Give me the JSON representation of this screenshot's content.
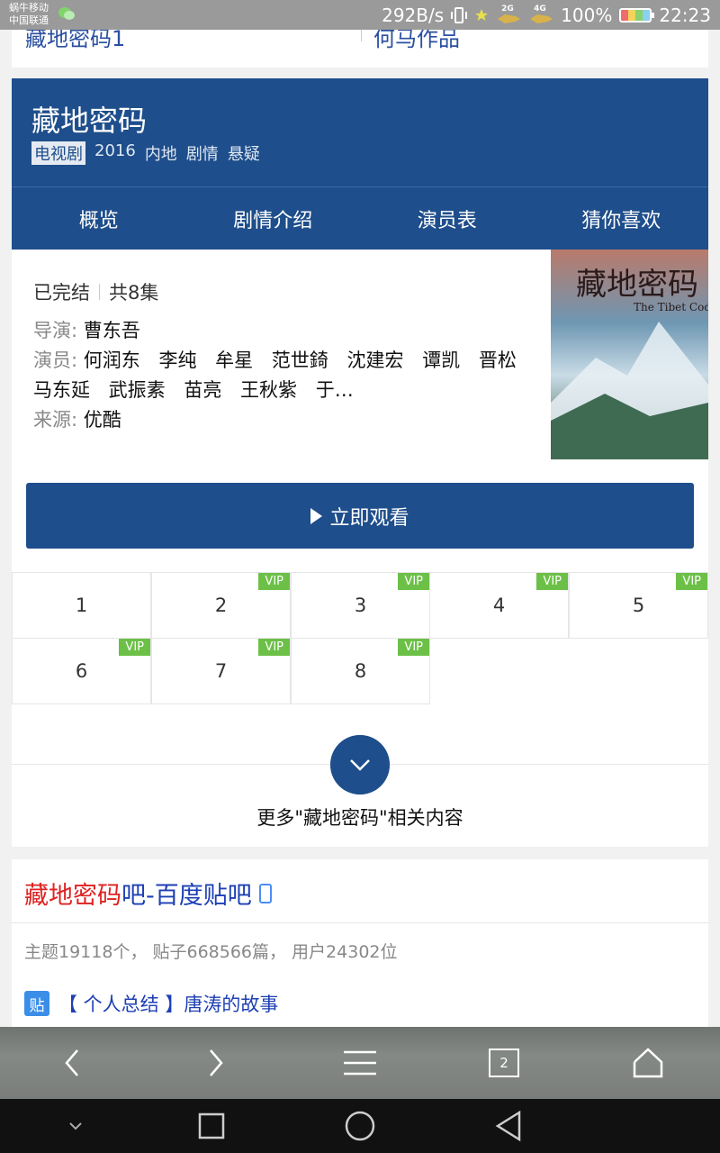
{
  "status_bar": {
    "carrier1": "蜗牛移动",
    "carrier2": "中国联通",
    "speed": "292B/s",
    "net1": "2G",
    "net2": "4G",
    "battery": "100%",
    "time": "22:23"
  },
  "prev_card": {
    "link_left": "藏地密码1",
    "link_right": "何马作品"
  },
  "show": {
    "title": "藏地密码",
    "tag": "电视剧",
    "year": "2016",
    "region": "内地",
    "genre1": "剧情",
    "genre2": "悬疑",
    "tabs": [
      "概览",
      "剧情介绍",
      "演员表",
      "猜你喜欢"
    ],
    "status": "已完结",
    "episode_count": "共8集",
    "director_label": "导演:",
    "director": "曹东吾",
    "cast_label": "演员:",
    "cast": "何润东 李纯 牟星 范世錡 沈建宏 谭凯 晋松 马东延 武振素 苗亮 王秋紫 于…",
    "source_label": "来源:",
    "source": "优酷",
    "watch_label": "立即观看",
    "poster_title_en": "The Tibet Code"
  },
  "episodes": [
    {
      "num": "1",
      "vip": ""
    },
    {
      "num": "2",
      "vip": "VIP"
    },
    {
      "num": "3",
      "vip": "VIP"
    },
    {
      "num": "4",
      "vip": "VIP"
    },
    {
      "num": "5",
      "vip": "VIP"
    },
    {
      "num": "6",
      "vip": "VIP"
    },
    {
      "num": "7",
      "vip": "VIP"
    },
    {
      "num": "8",
      "vip": "VIP"
    }
  ],
  "more_label": "更多\"藏地密码\"相关内容",
  "tieba": {
    "title_red": "藏地密码",
    "title_rest": "吧-百度贴吧",
    "stats": "主题19118个， 贴子668566篇， 用户24302位",
    "post_badge": "贴",
    "post_title": "【 个人总结 】唐涛的故事"
  },
  "toolbar": {
    "tab_count": "2"
  }
}
